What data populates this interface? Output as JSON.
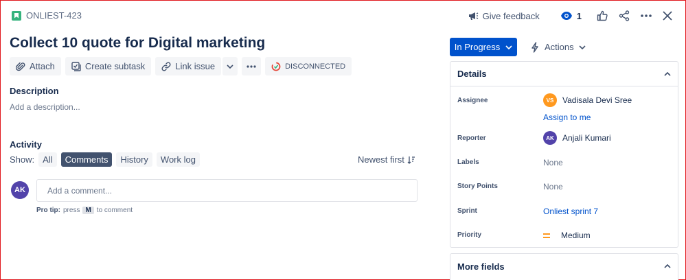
{
  "header": {
    "issue_key": "ONLIEST-423",
    "give_feedback": "Give feedback",
    "watch_count": "1"
  },
  "issue": {
    "title": "Collect 10 quote for Digital marketing"
  },
  "toolbar": {
    "attach": "Attach",
    "create_subtask": "Create subtask",
    "link_issue": "Link issue",
    "disconnected": "DISCONNECTED"
  },
  "description": {
    "label": "Description",
    "placeholder": "Add a description..."
  },
  "activity": {
    "label": "Activity",
    "show_label": "Show:",
    "filters": [
      "All",
      "Comments",
      "History",
      "Work log"
    ],
    "active_filter": "Comments",
    "sort": "Newest first",
    "comment_avatar": "AK",
    "comment_placeholder": "Add a comment...",
    "pro_tip_label": "Pro tip:",
    "pro_tip_press": "press",
    "pro_tip_key": "M",
    "pro_tip_suffix": "to comment"
  },
  "status": {
    "label": "In Progress",
    "actions": "Actions"
  },
  "details": {
    "title": "Details",
    "assignee_label": "Assignee",
    "assignee_initials": "VS",
    "assignee_name": "Vadisala Devi Sree",
    "assign_to_me": "Assign to me",
    "reporter_label": "Reporter",
    "reporter_initials": "AK",
    "reporter_name": "Anjali Kumari",
    "labels_label": "Labels",
    "labels_value": "None",
    "story_points_label": "Story Points",
    "story_points_value": "None",
    "sprint_label": "Sprint",
    "sprint_value": "Onliest sprint 7",
    "priority_label": "Priority",
    "priority_value": "Medium"
  },
  "more_fields": {
    "title": "More fields"
  },
  "colors": {
    "primary": "#0052cc",
    "assignee_avatar": "#ff991f",
    "reporter_avatar": "#5243aa",
    "story": "#36b37e",
    "priority_medium": "#ff991f"
  }
}
